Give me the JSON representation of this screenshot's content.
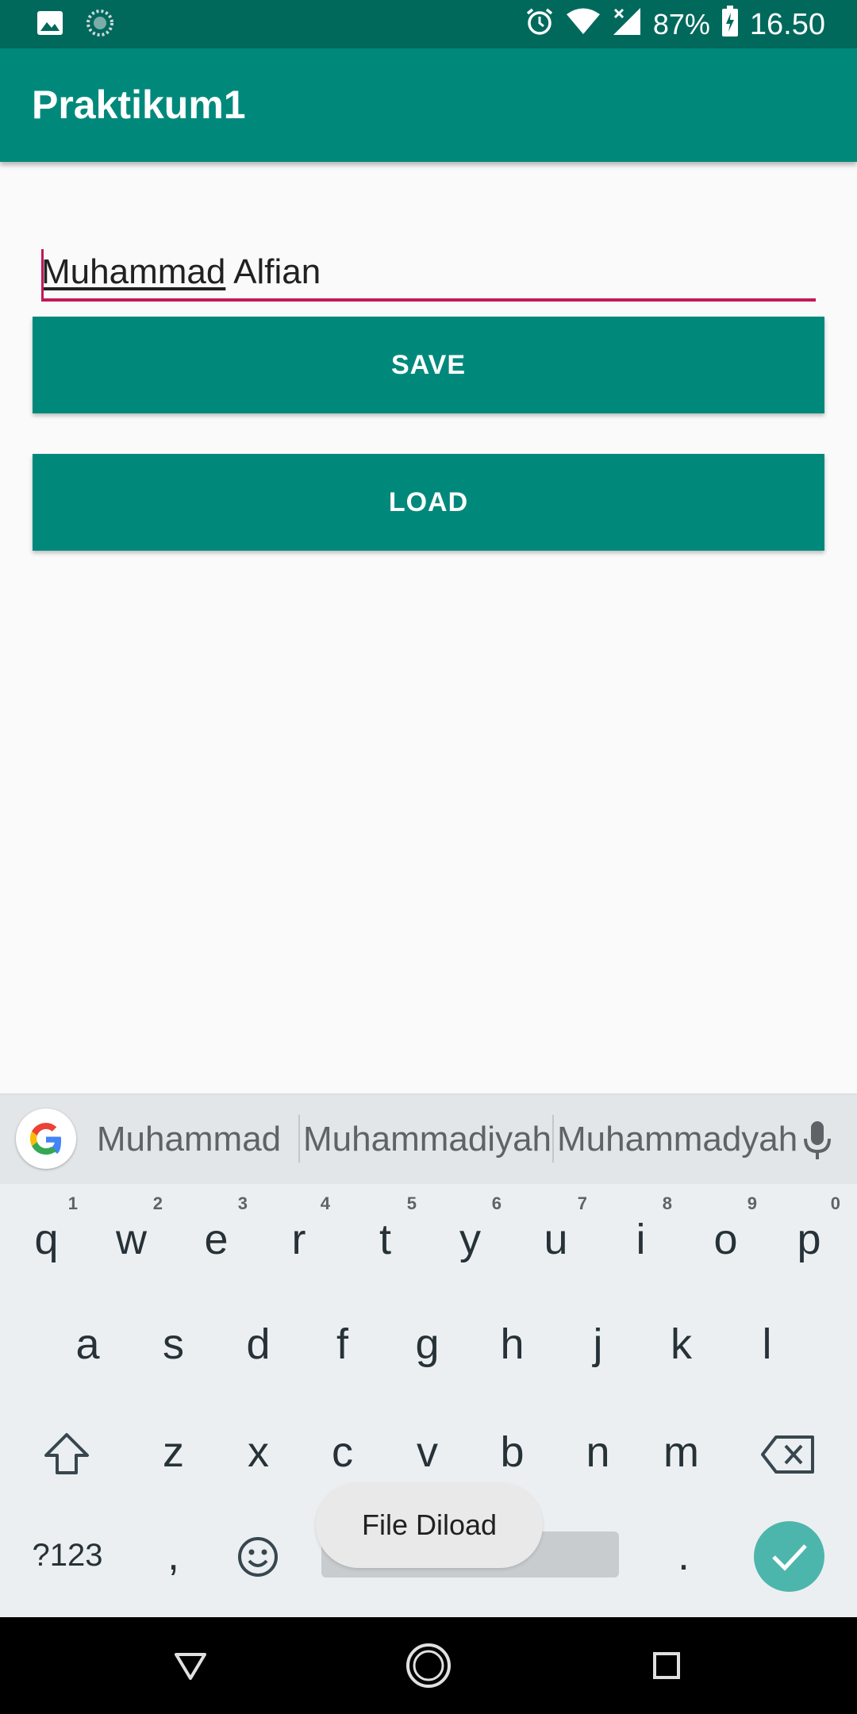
{
  "status_bar": {
    "battery": "87%",
    "time": "16.50",
    "icons": [
      "image-icon",
      "sync-icon",
      "alarm-icon",
      "wifi-icon",
      "signal-icon",
      "battery-charging-icon"
    ]
  },
  "app_bar": {
    "title": "Praktikum1"
  },
  "form": {
    "input_compose": "Muhammad",
    "input_rest": " Alfian",
    "save_label": "SAVE",
    "load_label": "LOAD"
  },
  "keyboard": {
    "suggestions": [
      "Muhammad",
      "Muhammadiyah",
      "Muhammadyah"
    ],
    "row1": [
      {
        "k": "q",
        "h": "1"
      },
      {
        "k": "w",
        "h": "2"
      },
      {
        "k": "e",
        "h": "3"
      },
      {
        "k": "r",
        "h": "4"
      },
      {
        "k": "t",
        "h": "5"
      },
      {
        "k": "y",
        "h": "6"
      },
      {
        "k": "u",
        "h": "7"
      },
      {
        "k": "i",
        "h": "8"
      },
      {
        "k": "o",
        "h": "9"
      },
      {
        "k": "p",
        "h": "0"
      }
    ],
    "row2": [
      "a",
      "s",
      "d",
      "f",
      "g",
      "h",
      "j",
      "k",
      "l"
    ],
    "row3": [
      "z",
      "x",
      "c",
      "v",
      "b",
      "n",
      "m"
    ],
    "symbols_label": "?123",
    "comma": ",",
    "period": "."
  },
  "toast": {
    "message": "File Diload"
  },
  "colors": {
    "primary": "#00897b",
    "primary_dark": "#00695c",
    "accent": "#c2185b",
    "enter_key": "#4db6ac"
  }
}
